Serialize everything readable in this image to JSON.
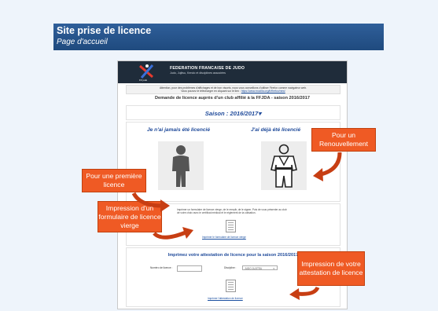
{
  "slide": {
    "title": "Site prise de licence",
    "subtitle": "Page d'accueil"
  },
  "screenshot": {
    "banner": {
      "org_name": "FEDERATION FRANCAISE DE JUDO",
      "tagline": "Judo, Jujitsu, Kendo et disciplines associées",
      "logo_label": "FF judo"
    },
    "notice": {
      "line1": "Attention, pour des problèmes d'affichages et de bon visuels, nous vous conseillons d'utiliser Firefox comme navigateur web.",
      "line2": "Vous pouvez le télécharger en cliquant sur le lien :",
      "link": "https://www.mozilla.org/fr/firefox/new/"
    },
    "request_title": "Demande de licence auprès d'un club affilié à la FFJDA - saison 2016/2017",
    "season_label": "Saison :",
    "season_value": "2016/2017",
    "new_license_title": "Je n'ai jamais été licencié",
    "renewal_title": "J'ai déjà été licencié",
    "blank_form_text": "Imprimer un formulaire de licence vierge, de le remplir, de le signer. Puis de vous présenter au club de votre choix avec le certificat médical et le règlement de la cotisation.",
    "blank_form_link": "Imprimer le formulaire de licence vierge",
    "attestation_title": "Imprimez votre attestation de licence pour la saison 2016/2017",
    "license_number_label": "Numéro de licence :",
    "license_number_value": "",
    "discipline_label": "Discipline :",
    "discipline_value": "JUDO JUJITSU",
    "attestation_link": "Imprimer l'attestation de licence"
  },
  "callouts": {
    "new": "Pour une première licence",
    "renewal": "Pour un Renouvellement",
    "blank_form": "Impression d'un formulaire de licence vierge",
    "attestation": "Impression de votre attestation de licence"
  },
  "colors": {
    "header": "#1f4a7e",
    "callout": "#ef5a24",
    "accent_blue": "#1f4a9a"
  }
}
